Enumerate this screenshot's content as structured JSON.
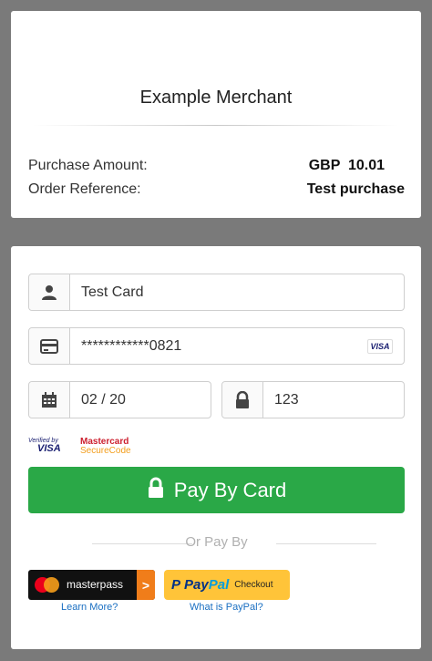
{
  "summary": {
    "merchant_name": "Example Merchant",
    "amount_label": "Purchase Amount:",
    "amount_value": "GBP  10.01",
    "reference_label": "Order Reference:",
    "reference_value": "Test purchase"
  },
  "form": {
    "cardholder_name": "Test Card",
    "card_number": "************0821",
    "card_brand": "VISA",
    "expiry": "02 / 20",
    "cvv": "123"
  },
  "trust": {
    "verified_by": "Verified by",
    "visa": "VISA",
    "mastercard": "Mastercard",
    "securecode": "SecureCode"
  },
  "actions": {
    "pay_button_label": "Pay By Card",
    "or_pay_by": "Or Pay By",
    "masterpass_label": "masterpass",
    "masterpass_arrow": ">",
    "paypal_p": "P",
    "paypal_pay": "Pay",
    "paypal_pal": "Pal",
    "paypal_checkout": "Checkout",
    "learn_more": "Learn More?",
    "what_is_paypal": "What is PayPal?"
  },
  "colors": {
    "background": "#7a7a7a",
    "pay_button": "#2aa847",
    "paypal_yellow": "#ffc439",
    "masterpass_orange": "#f07d1a",
    "link": "#1a6fc2"
  },
  "icons": {
    "name_field": "user-icon",
    "card_field": "credit-card-icon",
    "expiry_field": "calendar-icon",
    "cvv_field": "lock-icon",
    "pay_button": "lock-icon"
  }
}
